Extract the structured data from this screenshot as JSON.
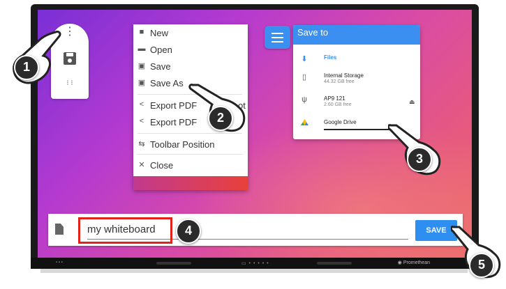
{
  "file_menu": {
    "items": [
      {
        "label": "New",
        "icon": "new-file-icon"
      },
      {
        "label": "Open",
        "icon": "folder-icon"
      },
      {
        "label": "Save",
        "icon": "save-icon"
      },
      {
        "label": "Save As",
        "icon": "save-as-icon"
      },
      {
        "label": "Export PDF",
        "icon": "share-icon"
      },
      {
        "label": "Export PDF",
        "icon": "share-icon"
      },
      {
        "label": "Toolbar Position",
        "icon": "toolbar-position-icon"
      },
      {
        "label": "Close",
        "icon": "close-icon"
      }
    ],
    "partial_text": "ot"
  },
  "save_to": {
    "title": "Save to",
    "destinations": [
      {
        "name": "Files",
        "sub": "",
        "icon": "download-icon"
      },
      {
        "name": "Internal Storage",
        "sub": "44.32 GB free",
        "icon": "phone-icon"
      },
      {
        "name": "AP9 121",
        "sub": "2.60 GB free",
        "icon": "usb-icon"
      },
      {
        "name": "Google Drive",
        "sub": "",
        "icon": "google-drive-icon"
      }
    ],
    "eject_icon": "eject-icon"
  },
  "filename_bar": {
    "value": "my whiteboard",
    "save_label": "SAVE"
  },
  "steps": [
    "1",
    "2",
    "3",
    "4",
    "5"
  ],
  "monitor": {
    "brand": "Promethean"
  },
  "colors": {
    "accent": "#2f8ff0",
    "highlight": "#e2231a",
    "menu_gradient": [
      "#c23a8e",
      "#e8413b"
    ]
  }
}
